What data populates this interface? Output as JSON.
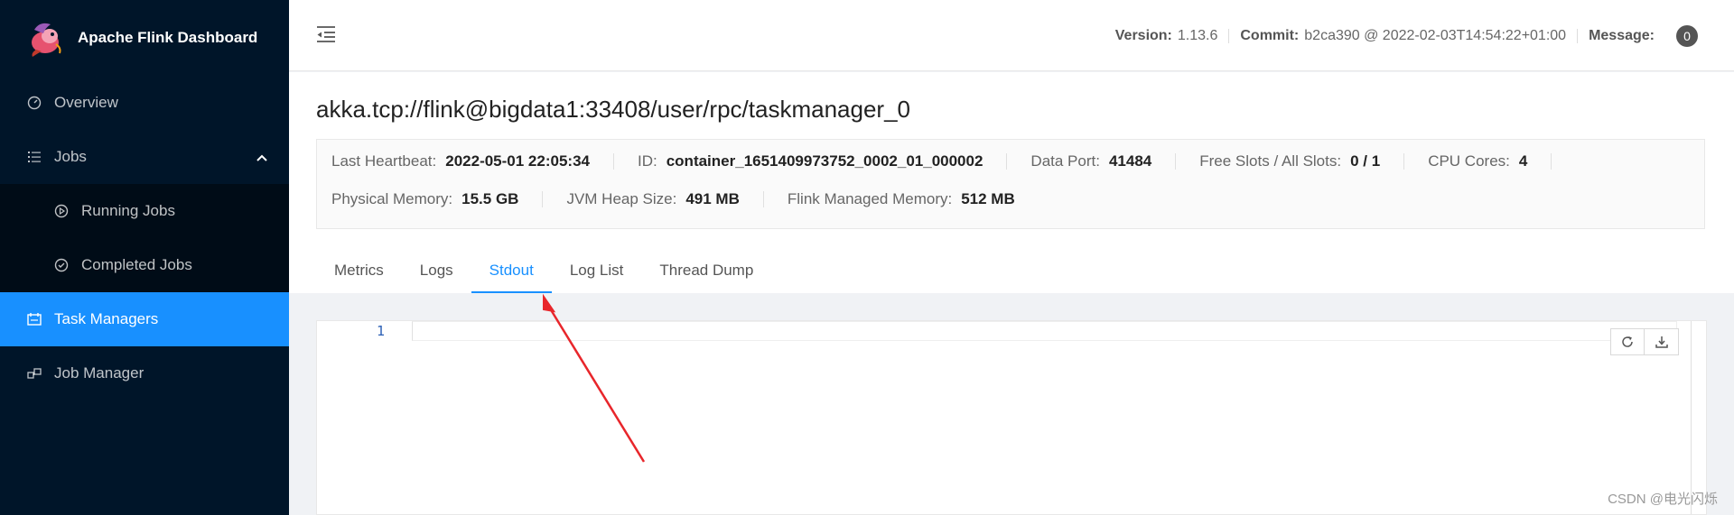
{
  "app": {
    "title": "Apache Flink Dashboard"
  },
  "sidebar": {
    "items": [
      {
        "label": "Overview",
        "icon": "dashboard-icon"
      },
      {
        "label": "Jobs",
        "icon": "list-icon"
      },
      {
        "label": "Running Jobs",
        "icon": "play-circle-icon"
      },
      {
        "label": "Completed Jobs",
        "icon": "check-circle-icon"
      },
      {
        "label": "Task Managers",
        "icon": "schedule-icon"
      },
      {
        "label": "Job Manager",
        "icon": "cluster-icon"
      }
    ]
  },
  "header": {
    "version_label": "Version:",
    "version": "1.13.6",
    "commit_label": "Commit:",
    "commit": "b2ca390 @ 2022-02-03T14:54:22+01:00",
    "message_label": "Message:",
    "message_count": "0"
  },
  "page": {
    "title": "akka.tcp://flink@bigdata1:33408/user/rpc/taskmanager_0",
    "details": {
      "last_heartbeat_label": "Last Heartbeat:",
      "last_heartbeat": "2022-05-01 22:05:34",
      "id_label": "ID:",
      "id": "container_1651409973752_0002_01_000002",
      "data_port_label": "Data Port:",
      "data_port": "41484",
      "slots_label": "Free Slots / All Slots:",
      "slots": "0 / 1",
      "cpu_label": "CPU Cores:",
      "cpu": "4",
      "physical_memory_label": "Physical Memory:",
      "physical_memory": "15.5 GB",
      "jvm_heap_label": "JVM Heap Size:",
      "jvm_heap": "491 MB",
      "flink_memory_label": "Flink Managed Memory:",
      "flink_memory": "512 MB"
    },
    "tabs": [
      "Metrics",
      "Logs",
      "Stdout",
      "Log List",
      "Thread Dump"
    ],
    "active_tab": "Stdout"
  },
  "editor": {
    "line_number": "1"
  },
  "colors": {
    "sidebar_bg": "#001529",
    "accent": "#1890ff",
    "annotation_arrow": "#e8262b"
  },
  "watermark": "CSDN @电光闪烁"
}
